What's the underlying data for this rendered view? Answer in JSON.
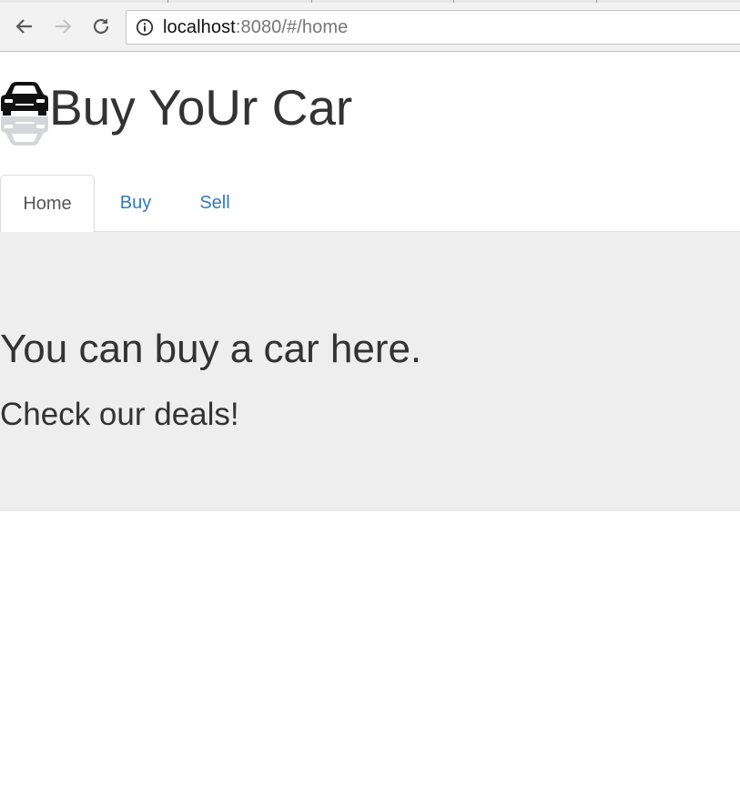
{
  "browser": {
    "url_host": "localhost",
    "url_rest": ":8080/#/home",
    "icons": {
      "back": "arrow-left-icon",
      "forward": "arrow-right-icon",
      "reload": "reload-icon",
      "info": "info-icon"
    }
  },
  "header": {
    "title": "Buy YoUr Car",
    "logo_icon": "car-logo-icon"
  },
  "nav": {
    "tabs": [
      {
        "label": "Home",
        "active": true
      },
      {
        "label": "Buy",
        "active": false
      },
      {
        "label": "Sell",
        "active": false
      }
    ]
  },
  "jumbotron": {
    "heading": "You can buy a car here.",
    "subheading": "Check our deals!"
  },
  "colors": {
    "link": "#337ab7",
    "text": "#333333",
    "jumbotron_bg": "#eeeeee",
    "border": "#dddddd"
  }
}
